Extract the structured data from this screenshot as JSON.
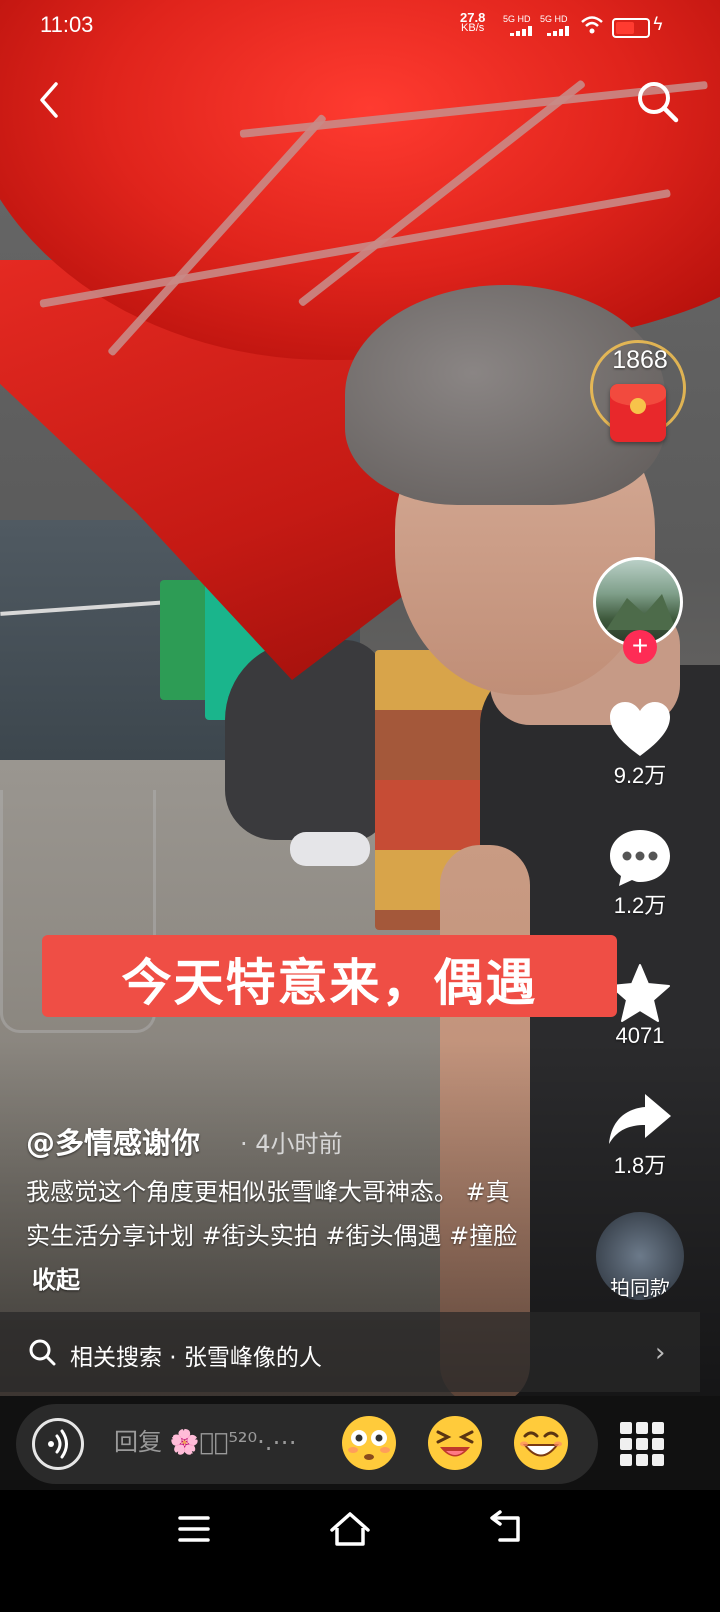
{
  "status_bar": {
    "time": "11:03",
    "net_speed": "27.8",
    "net_unit": "KB/s",
    "sim1": "5G HD",
    "sim2": "5G HD",
    "battery_color": "#ff3b30"
  },
  "top_bar": {
    "back_icon": "chevron-left-icon",
    "search_icon": "search-icon"
  },
  "red_packet": {
    "count": "1868",
    "icon": "red-envelope-icon"
  },
  "creator": {
    "follow_symbol": "+",
    "follow_color": "#fe2c55"
  },
  "actions": {
    "like_count": "9.2万",
    "comment_count": "1.2万",
    "favorite_count": "4071",
    "share_count": "1.8万",
    "same_style_label": "拍同款"
  },
  "video_caption": {
    "overlay_text": "今天特意来，偶遇",
    "banner_color": "#ef4e45"
  },
  "post": {
    "author": "@多情感谢你",
    "time": "· 4小时前",
    "description": "我感觉这个角度更相似张雪峰大哥神态。 #真实生活分享计划 #街头实拍 #街头偶遇 #撞脸",
    "collapse_label": "收起"
  },
  "related_search": {
    "text": "相关搜索 · 张雪峰像的人",
    "chevron": "›"
  },
  "reply_bar": {
    "placeholder": "回复 🌸ꦿ͙⁵²⁰·.⋯",
    "emojis": [
      "flushed-face",
      "laughing-squint-face",
      "grinning-face"
    ]
  },
  "nav_bar": {
    "buttons": [
      "menu-icon",
      "home-icon",
      "back-icon"
    ]
  }
}
